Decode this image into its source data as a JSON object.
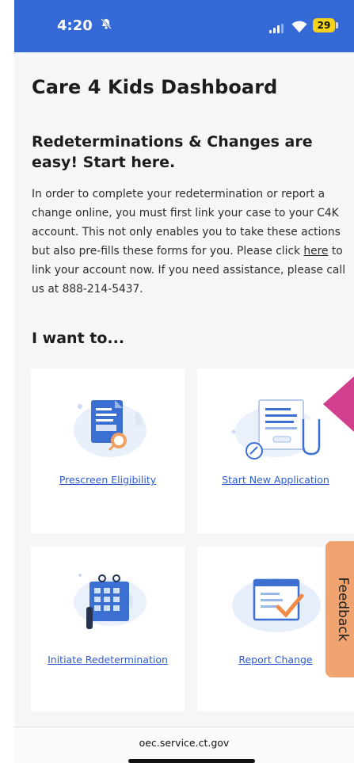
{
  "status_bar": {
    "time": "4:20",
    "battery": "29",
    "bell_icon": "bell-slash-icon"
  },
  "page": {
    "title": "Care 4 Kids Dashboard",
    "subtitle": "Redeterminations & Changes are easy! Start here.",
    "intro_before": "In order to complete your redetermination or report a change online, you must first link your case to your C4K account. This not only enables you to take these actions but also pre-fills these forms for you. Please click ",
    "intro_link": "here",
    "intro_after": " to link your account now. If you need assistance, please call us at 888-214-5437.",
    "section_heading": "I want to..."
  },
  "cards": [
    {
      "label": "Prescreen Eligibility",
      "icon": "document-search-icon"
    },
    {
      "label": "Start New Application",
      "icon": "application-form-icon"
    },
    {
      "label": "Initiate Redetermination",
      "icon": "calendar-icon"
    },
    {
      "label": "Report Change",
      "icon": "checklist-icon"
    }
  ],
  "feedback": {
    "label": "Feedback"
  },
  "browser": {
    "url": "oec.service.ct.gov"
  },
  "colors": {
    "status_bar": "#3569d6",
    "link": "#2d5bd6",
    "feedback_tab": "#f0a36f",
    "accent_pink": "#d13f8e"
  }
}
